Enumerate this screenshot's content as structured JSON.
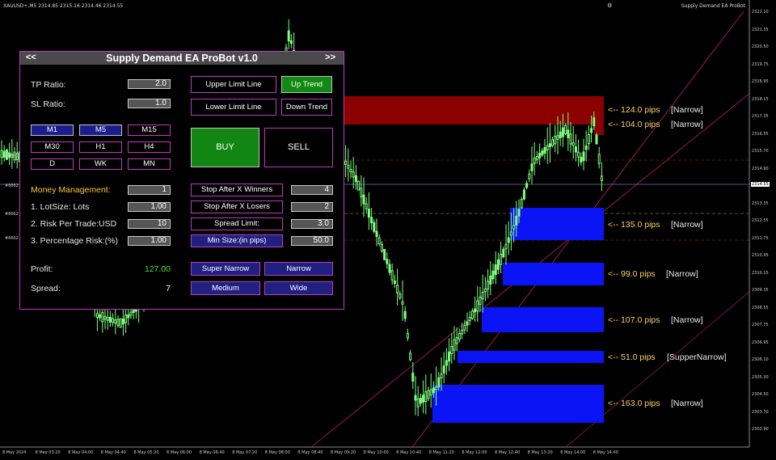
{
  "header": {
    "symbol_info": "XAUUSD+,M5  2314.85 2315.16 2314.46 2314.55",
    "ea_name": "Supply Demand EA ProBot"
  },
  "price_axis": [
    "2322.10",
    "2321.35",
    "2320.50",
    "2319.75",
    "2318.95",
    "2318.15",
    "2317.35",
    "2316.55",
    "2315.70",
    "2314.90",
    "2314.10",
    "2313.35",
    "2312.55",
    "2311.75",
    "2310.95",
    "2310.15",
    "2309.35",
    "2308.55",
    "2307.75",
    "2306.95",
    "2306.10",
    "2305.30",
    "2304.50",
    "2303.70",
    "2302.90"
  ],
  "current_price": "2314.55",
  "time_axis": [
    "8 May 2024",
    "8 May 03:20",
    "8 May 04:00",
    "8 May 04:40",
    "8 May 05:20",
    "8 May 06:00",
    "8 May 06:40",
    "8 May 07:20",
    "8 May 08:00",
    "8 May 08:40",
    "8 May 09:20",
    "8 May 10:00",
    "8 May 10:40",
    "8 May 11:20",
    "8 May 12:00",
    "8 May 12:40",
    "8 May 13:20",
    "8 May 14:00",
    "8 May 14:40"
  ],
  "left_tags": [
    "#6662",
    "#6662",
    "#6662",
    "#6662"
  ],
  "zones": [
    {
      "pips": "<-- 124.0 pips",
      "type": "[Narrow]",
      "color": "#8b0000"
    },
    {
      "pips": "<-- 104.0 pips",
      "type": "[Narrow]",
      "color": "#8b0000"
    },
    {
      "pips": "<-- 135.0 pips",
      "type": "[Narrow]",
      "color": "#0a14f5"
    },
    {
      "pips": "<-- 99.0 pips",
      "type": "[Narrow]",
      "color": "#0a14f5"
    },
    {
      "pips": "<-- 107.0 pips",
      "type": "[Narrow]",
      "color": "#0a14f5"
    },
    {
      "pips": "<-- 51.0 pips",
      "type": "[SupperNarrow]",
      "color": "#0a14f5"
    },
    {
      "pips": "<-- 163.0 pips",
      "type": "[Narrow]",
      "color": "#0a14f5"
    }
  ],
  "panel": {
    "title": "Supply Demand EA ProBot v1.0",
    "nav_prev": "<<",
    "nav_next": ">>",
    "tp_ratio_label": "TP Ratio:",
    "tp_ratio": "2.0",
    "sl_ratio_label": "SL Ratio:",
    "sl_ratio": "1.0",
    "timeframes": [
      "M1",
      "M5",
      "M15",
      "M30",
      "H1",
      "H4",
      "D",
      "WK",
      "MN"
    ],
    "upper_limit_line": "Upper Limit Line",
    "lower_limit_line": "Lower Limit Line",
    "up_trend": "Up Trend",
    "down_trend": "Down Trend",
    "buy": "BUY",
    "sell": "SELL",
    "money_management_label": "Money Management:",
    "money_management": "1",
    "lot_size_label": "1. LotSize: Lots",
    "lot_size": "1.00",
    "risk_per_trade_label": "2. Risk Per Trade:USD",
    "risk_per_trade": "10",
    "percentage_risk_label": "3. Percentage Risk:(%)",
    "percentage_risk": "1.00",
    "stop_after_winners": "Stop After X Winners",
    "winners": "4",
    "stop_after_losers": "Stop After X Losers",
    "losers": "2",
    "spread_limit": "Spread Limit:",
    "spread_limit_value": "3.0",
    "min_size": "Min Size:(in pips)",
    "min_size_value": "50.0",
    "profit_label": "Profit:",
    "profit": "127.00",
    "spread_label": "Spread:",
    "spread": "7",
    "super_narrow": "Super Narrow",
    "narrow": "Narrow",
    "medium": "Medium",
    "wide": "Wide"
  }
}
